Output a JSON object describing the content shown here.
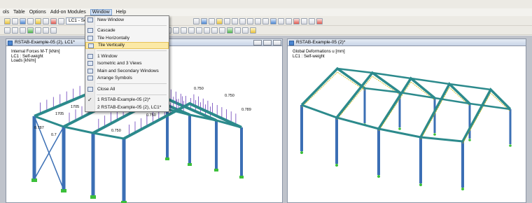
{
  "menubar": {
    "items": [
      {
        "label": "ols"
      },
      {
        "label": "Table"
      },
      {
        "label": "Options"
      },
      {
        "label": "Add-on Modules"
      },
      {
        "label": "Window"
      },
      {
        "label": "Help"
      }
    ]
  },
  "toolbar": {
    "load_case": "LC1 - Self-weig"
  },
  "window_menu": {
    "items": [
      {
        "label": "New Window",
        "icon": "new-window-icon"
      },
      {
        "sep": true
      },
      {
        "label": "Cascade",
        "icon": "cascade-icon"
      },
      {
        "label": "Tile Horizontally",
        "icon": "tile-horizontal-icon"
      },
      {
        "label": "Tile Vertically",
        "icon": "tile-vertical-icon",
        "highlighted": true
      },
      {
        "sep": true
      },
      {
        "label": "1 Window",
        "icon": "one-window-icon"
      },
      {
        "label": "Isometric and 3 Views",
        "icon": "isometric-views-icon"
      },
      {
        "label": "Main and Secondary Windows",
        "icon": "main-secondary-icon"
      },
      {
        "label": "Arrange Symbols",
        "icon": "arrange-icon"
      },
      {
        "sep": true
      },
      {
        "label": "Close All",
        "icon": "close-all-icon"
      },
      {
        "sep": true
      },
      {
        "label": "1 RSTAB-Example-05 (2)*",
        "checked": true
      },
      {
        "label": "2 RSTAB-Example-05 (2), LC1*"
      }
    ]
  },
  "left_window": {
    "title": "RSTAB-Example-05 (2), LC1*",
    "info_lines": [
      "Internal Forces M-T [kNm]",
      "LC1 : Self-weight",
      "Loads [kN/m]"
    ],
    "values": [
      "1705",
      "1705",
      "0.750",
      "0.750",
      "0.789",
      "0.787",
      "0.7",
      "0.750",
      "0.750"
    ]
  },
  "right_window": {
    "title": "RSTAB-Example-05 (2)*",
    "info_lines": [
      "Global Deformations u [mm]",
      "LC1 : Self-weight"
    ]
  },
  "colors": {
    "member": "#3b6fb5",
    "member_dark": "#1f4f88",
    "beam": "#2c8a8c",
    "load": "#6a3fb8",
    "support": "#3cbf3a"
  }
}
